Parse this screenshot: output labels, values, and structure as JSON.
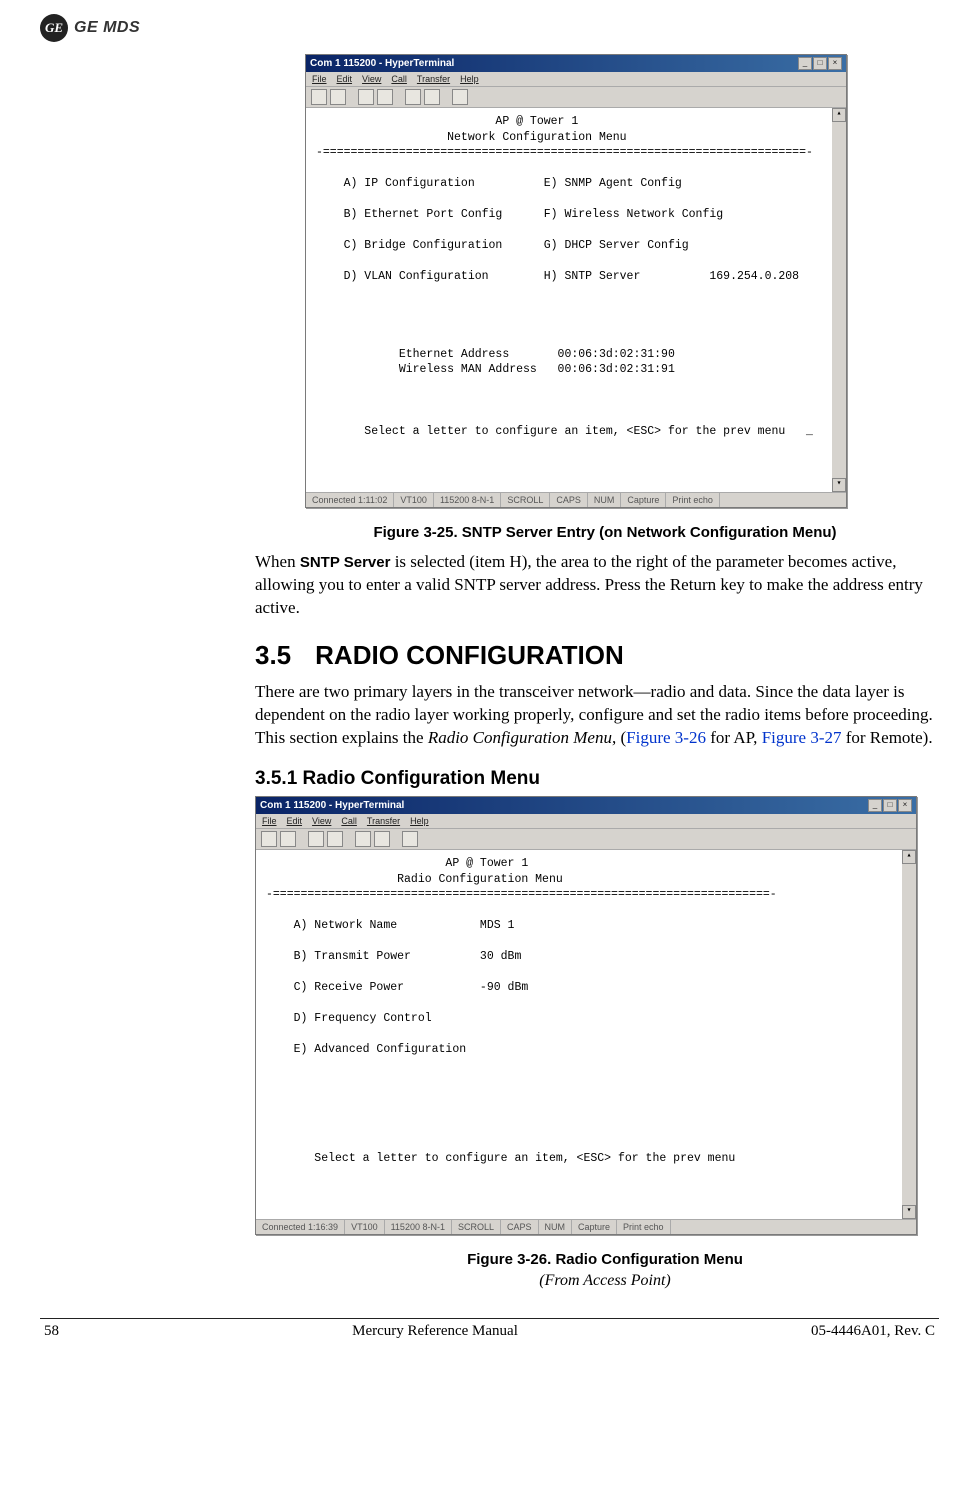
{
  "header": {
    "monogram": "GE",
    "brand": "GE MDS"
  },
  "terminal1": {
    "title": "Com 1 115200 - HyperTerminal",
    "menu": [
      "File",
      "Edit",
      "View",
      "Call",
      "Transfer",
      "Help"
    ],
    "body": "                          AP @ Tower 1\n                   Network Configuration Menu\n-======================================================================-\n\n    A) IP Configuration          E) SNMP Agent Config\n\n    B) Ethernet Port Config      F) Wireless Network Config\n\n    C) Bridge Configuration      G) DHCP Server Config\n\n    D) VLAN Configuration        H) SNTP Server          169.254.0.208\n\n\n\n\n            Ethernet Address       00:06:3d:02:31:90\n            Wireless MAN Address   00:06:3d:02:31:91\n\n\n\n       Select a letter to configure an item, <ESC> for the prev menu   _",
    "status": {
      "conn": "Connected 1:11:02",
      "emu": "VT100",
      "cfg": "115200 8-N-1",
      "s1": "SCROLL",
      "s2": "CAPS",
      "s3": "NUM",
      "s4": "Capture",
      "s5": "Print echo"
    }
  },
  "caption1": "Figure 3-25. SNTP Server Entry (on Network Configuration Menu)",
  "para1_a": "When ",
  "para1_b": "SNTP Server",
  "para1_c": " is selected (item H), the area to the right of the param­eter becomes active, allowing you to enter a valid SNTP server address. Press the Return key to make the address entry active.",
  "section_num": "3.5",
  "section_title": "RADIO CONFIGURATION",
  "para2_a": "There are two primary layers in the transceiver network—radio and data. Since the data layer is dependent on the radio layer working prop­erly, configure and set the radio items before proceeding. This section explains the ",
  "para2_b": "Radio Configuration Menu",
  "para2_c": ", (",
  "para2_d": "Figure 3-26",
  "para2_e": " for AP, ",
  "para2_f": "Figure 3-27",
  "para2_g": " for Remote).",
  "subsection": "3.5.1 Radio Configuration Menu",
  "terminal2": {
    "title": "Com 1 115200 - HyperTerminal",
    "menu": [
      "File",
      "Edit",
      "View",
      "Call",
      "Transfer",
      "Help"
    ],
    "body": "                          AP @ Tower 1\n                   Radio Configuration Menu\n-========================================================================-\n\n    A) Network Name            MDS 1\n\n    B) Transmit Power          30 dBm\n\n    C) Receive Power           -90 dBm\n\n    D) Frequency Control\n\n    E) Advanced Configuration\n\n\n\n\n\n\n       Select a letter to configure an item, <ESC> for the prev menu",
    "status": {
      "conn": "Connected 1:16:39",
      "emu": "VT100",
      "cfg": "115200 8-N-1",
      "s1": "SCROLL",
      "s2": "CAPS",
      "s3": "NUM",
      "s4": "Capture",
      "s5": "Print echo"
    }
  },
  "caption2": "Figure 3-26. Radio Configuration Menu",
  "subcaption2": "(From Access Point)",
  "footer": {
    "page": "58",
    "title": "Mercury Reference Manual",
    "doc": "05-4446A01, Rev. C"
  }
}
